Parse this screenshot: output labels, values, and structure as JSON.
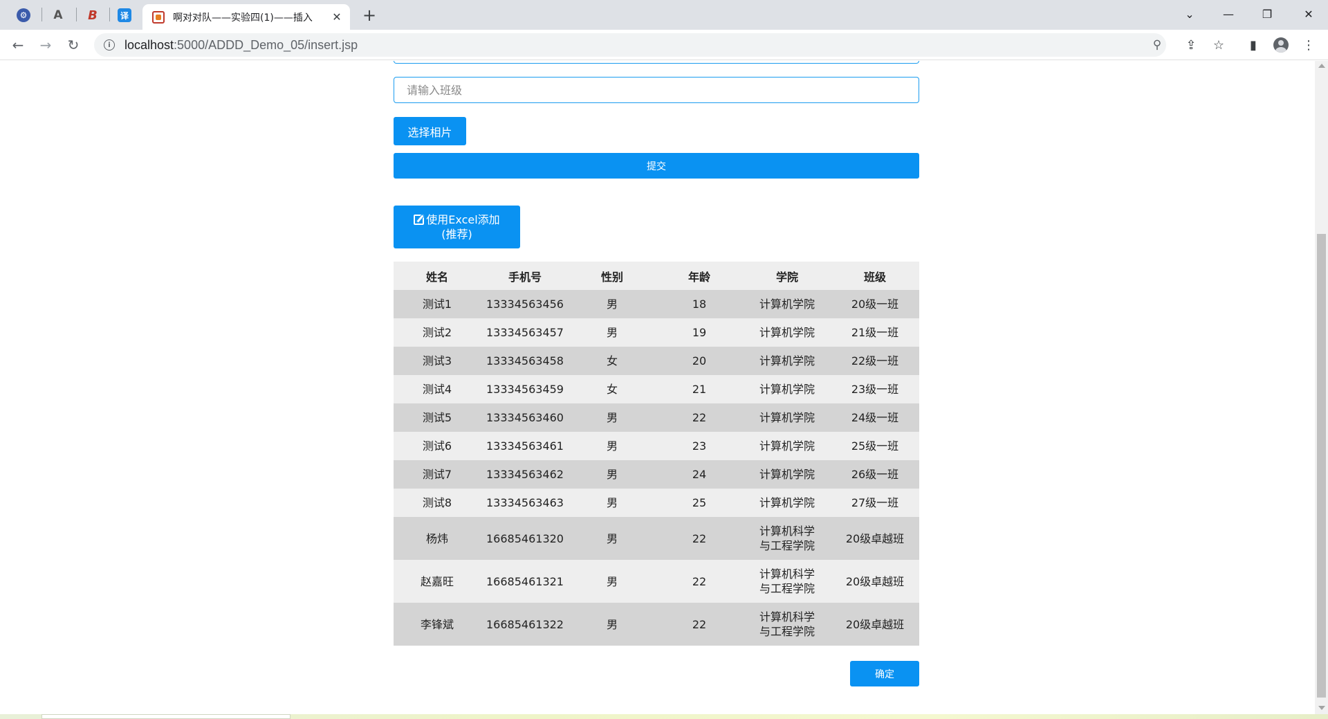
{
  "browser": {
    "active_tab_title": "啊对对队——实验四(1)——插入",
    "url_host": "localhost",
    "url_rest": ":5000/ADDD_Demo_05/insert.jsp",
    "pinned_tabs": [
      {
        "glyph": "⚙",
        "color": "#3b5bab"
      },
      {
        "glyph": "A",
        "color": "#555555"
      },
      {
        "glyph": "B",
        "color": "#c0392b"
      },
      {
        "glyph": "译",
        "color": "#1e88e5"
      }
    ]
  },
  "form": {
    "class_placeholder": "请输入班级",
    "photo_button": "选择相片",
    "submit_button": "提交",
    "excel_button_line1": "使用Excel添加",
    "excel_button_line2": "(推荐)"
  },
  "table": {
    "columns": [
      "姓名",
      "手机号",
      "性别",
      "年龄",
      "学院",
      "班级"
    ],
    "rows": [
      {
        "name": "测试1",
        "phone": "13334563456",
        "gender": "男",
        "age": "18",
        "college": "计算机学院",
        "class": "20级一班"
      },
      {
        "name": "测试2",
        "phone": "13334563457",
        "gender": "男",
        "age": "19",
        "college": "计算机学院",
        "class": "21级一班"
      },
      {
        "name": "测试3",
        "phone": "13334563458",
        "gender": "女",
        "age": "20",
        "college": "计算机学院",
        "class": "22级一班"
      },
      {
        "name": "测试4",
        "phone": "13334563459",
        "gender": "女",
        "age": "21",
        "college": "计算机学院",
        "class": "23级一班"
      },
      {
        "name": "测试5",
        "phone": "13334563460",
        "gender": "男",
        "age": "22",
        "college": "计算机学院",
        "class": "24级一班"
      },
      {
        "name": "测试6",
        "phone": "13334563461",
        "gender": "男",
        "age": "23",
        "college": "计算机学院",
        "class": "25级一班"
      },
      {
        "name": "测试7",
        "phone": "13334563462",
        "gender": "男",
        "age": "24",
        "college": "计算机学院",
        "class": "26级一班"
      },
      {
        "name": "测试8",
        "phone": "13334563463",
        "gender": "男",
        "age": "25",
        "college": "计算机学院",
        "class": "27级一班"
      },
      {
        "name": "杨炜",
        "phone": "16685461320",
        "gender": "男",
        "age": "22",
        "college_l1": "计算机科学",
        "college_l2": "与工程学院",
        "class": "20级卓越班"
      },
      {
        "name": "赵嘉旺",
        "phone": "16685461321",
        "gender": "男",
        "age": "22",
        "college_l1": "计算机科学",
        "college_l2": "与工程学院",
        "class": "20级卓越班"
      },
      {
        "name": "李锋斌",
        "phone": "16685461322",
        "gender": "男",
        "age": "22",
        "college_l1": "计算机科学",
        "college_l2": "与工程学院",
        "class": "20级卓越班"
      }
    ]
  },
  "confirm_button": "确定",
  "colors": {
    "accent": "#0a92f2",
    "row_dark": "#d4d4d4",
    "row_light": "#eeeeee"
  }
}
